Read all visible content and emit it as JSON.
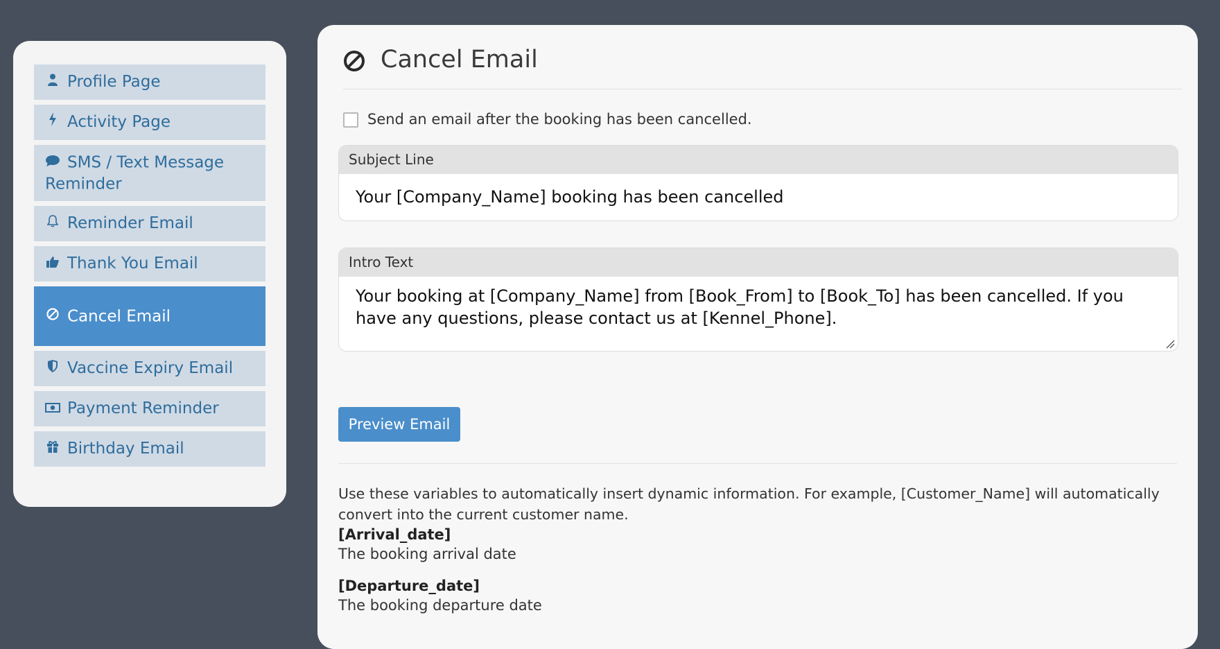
{
  "sidebar": {
    "items": [
      {
        "label": "Profile Page",
        "icon": "user-icon"
      },
      {
        "label": "Activity Page",
        "icon": "bolt-icon"
      },
      {
        "label": "SMS / Text Message Reminder",
        "icon": "chat-icon"
      },
      {
        "label": "Reminder Email",
        "icon": "bell-icon"
      },
      {
        "label": "Thank You Email",
        "icon": "thumbs-up-icon"
      },
      {
        "label": "Cancel Email",
        "icon": "ban-icon",
        "active": true
      },
      {
        "label": "Vaccine Expiry Email",
        "icon": "shield-icon"
      },
      {
        "label": "Payment Reminder",
        "icon": "money-icon"
      },
      {
        "label": "Birthday Email",
        "icon": "gift-icon"
      }
    ]
  },
  "main": {
    "title": "Cancel Email",
    "checkbox_label": "Send an email after the booking has been cancelled.",
    "checkbox_checked": false,
    "subject": {
      "label": "Subject Line",
      "value": "Your [Company_Name] booking has been cancelled"
    },
    "intro": {
      "label": "Intro Text",
      "value": "Your booking at [Company_Name] from [Book_From] to [Book_To] has been cancelled. If you have any questions, please contact us at [Kennel_Phone]."
    },
    "preview_button": "Preview Email",
    "help_text": "Use these variables to automatically insert dynamic information. For example, [Customer_Name] will automatically convert into the current customer name.",
    "variables": [
      {
        "name": "[Arrival_date]",
        "desc": "The booking arrival date"
      },
      {
        "name": "[Departure_date]",
        "desc": "The booking departure date"
      }
    ]
  },
  "colors": {
    "background": "#474f5c",
    "accent": "#4a8ecb",
    "nav_item": "#d0dae5",
    "nav_text": "#2f6d9c"
  }
}
